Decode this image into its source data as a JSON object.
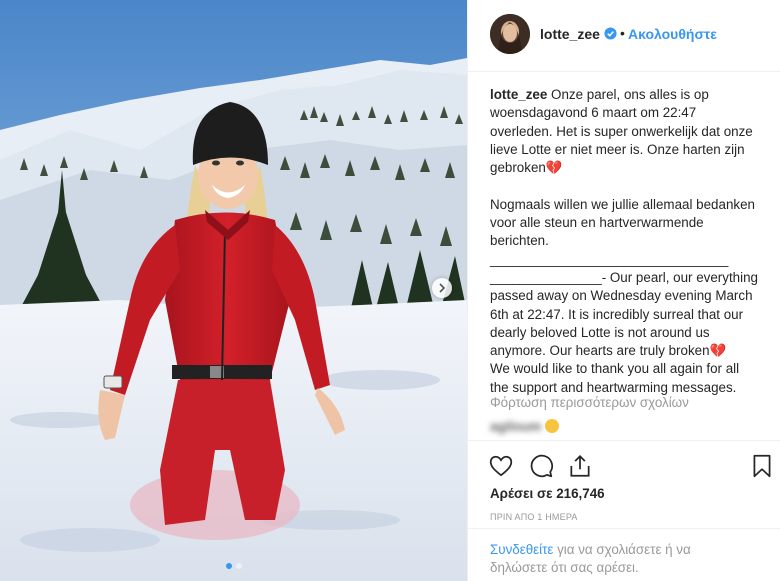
{
  "post": {
    "username": "lotte_zee",
    "follow_label": "Ακολουθήστε",
    "dot": "•",
    "caption_user": "lotte_zee",
    "caption_text": " Onze parel, ons alles is op woensdagavond 6 maart om 22:47 overleden. Het is super onwerkelijk dat onze lieve Lotte er niet meer is. Onze harten zijn gebroken",
    "heart_emoji": "💔",
    "caption_p2": "\n\nNogmaals willen we jullie allemaal bedanken voor alle steun en hartverwarmende berichten.\n________________________________\n_______________- Our pearl, our everything passed away on Wednesday evening March 6th at 22:47. It is incredibly surreal that our dearly beloved Lotte is not around us anymore. Our hearts are truly broken",
    "caption_p3": "\nWe would like to thank you all again for all the support and heartwarming messages.",
    "load_more": "Φόρτωση περισσότερων σχολίων",
    "blurred_comment_user": "agiloum",
    "likes": "Αρέσει σε 216,746",
    "time": "ΠΡΙΝ ΑΠΟ 1 ΗΜΕΡΑ",
    "login_link": "Συνδεθείτε",
    "login_rest": " για να σχολιάσετε ή να δηλώσετε ότι σας αρέσει."
  },
  "icons": {
    "verified": "verified-badge-icon",
    "like": "heart-icon",
    "comment": "comment-icon",
    "share": "share-icon",
    "save": "bookmark-icon",
    "next": "chevron-right-icon"
  },
  "colors": {
    "accent": "#3897f0",
    "suit": "#d3202a",
    "secondary_text": "#999999"
  },
  "carousel": {
    "total": 2,
    "active": 1
  }
}
